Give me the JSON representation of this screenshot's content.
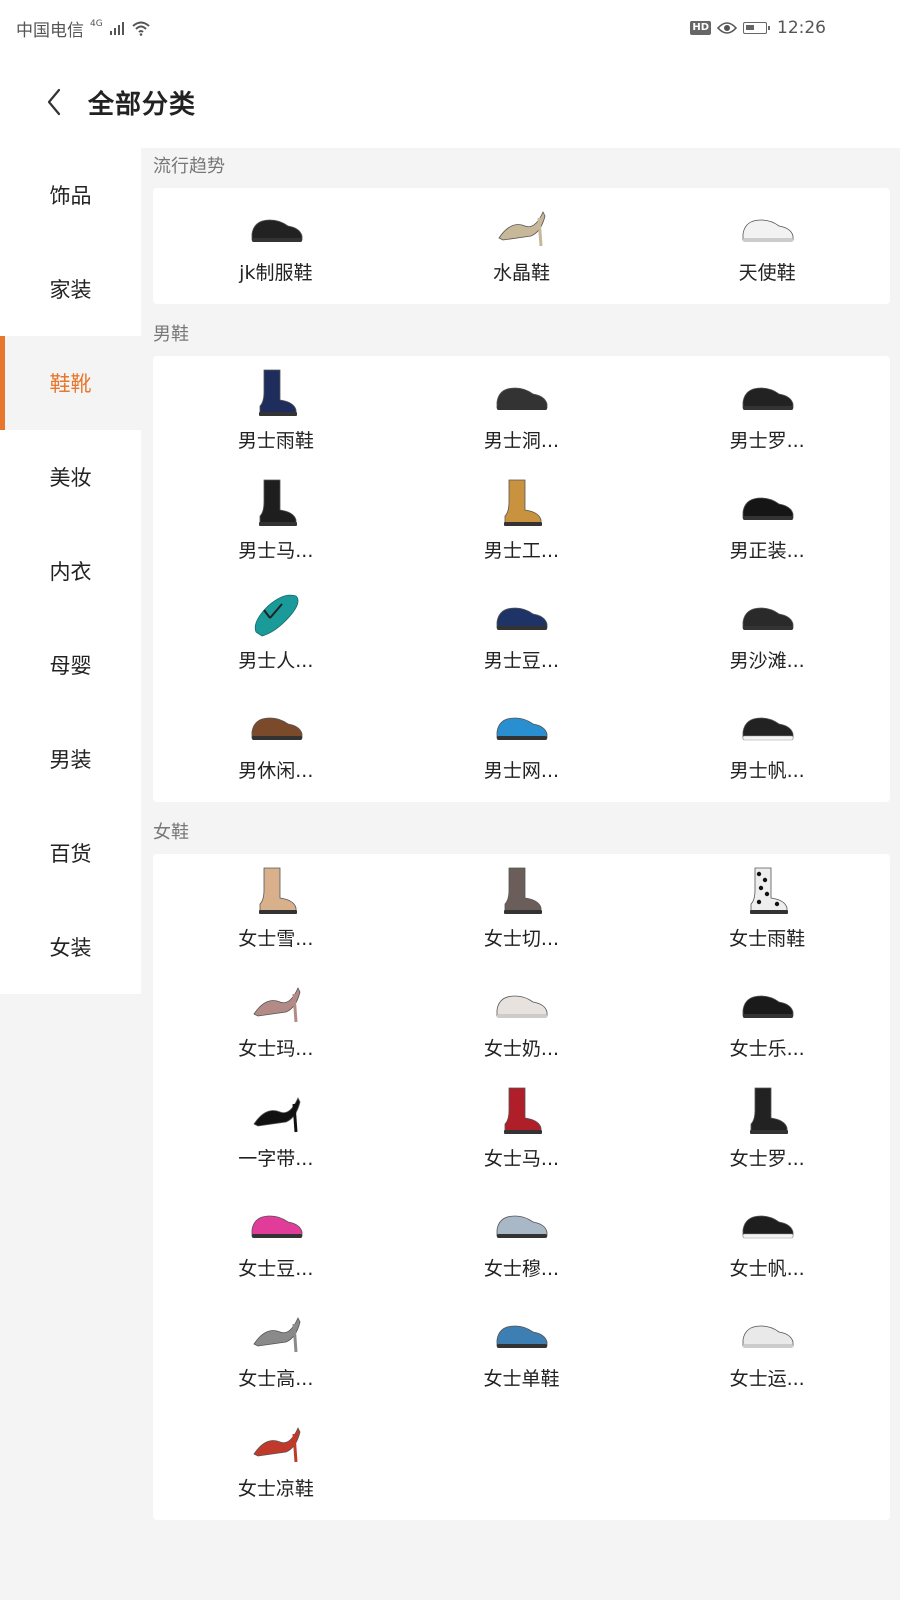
{
  "status": {
    "carrier": "中国电信",
    "network": "4G",
    "time": "12:26"
  },
  "header": {
    "title": "全部分类"
  },
  "sidebar": {
    "items": [
      {
        "label": "饰品"
      },
      {
        "label": "家装"
      },
      {
        "label": "鞋靴",
        "active": true
      },
      {
        "label": "美妆"
      },
      {
        "label": "内衣"
      },
      {
        "label": "母婴"
      },
      {
        "label": "男装"
      },
      {
        "label": "百货"
      },
      {
        "label": "女装"
      }
    ]
  },
  "colors": {
    "accent": "#e8772e",
    "background": "#f4f4f4"
  },
  "sections": [
    {
      "title": "流行趋势",
      "items": [
        {
          "label": "jk制服鞋",
          "icon": "black-loafer-icon"
        },
        {
          "label": "水晶鞋",
          "icon": "crystal-heel-icon"
        },
        {
          "label": "天使鞋",
          "icon": "white-nurse-shoe-icon"
        }
      ]
    },
    {
      "title": "男鞋",
      "items": [
        {
          "label": "男士雨鞋",
          "icon": "rain-boot-icon"
        },
        {
          "label": "男士洞...",
          "icon": "clog-icon"
        },
        {
          "label": "男士罗...",
          "icon": "sandal-icon"
        },
        {
          "label": "男士马...",
          "icon": "martin-boot-icon"
        },
        {
          "label": "男士工...",
          "icon": "work-boot-icon"
        },
        {
          "label": "男正装...",
          "icon": "dress-shoe-icon"
        },
        {
          "label": "男士人...",
          "icon": "flip-flop-icon"
        },
        {
          "label": "男士豆...",
          "icon": "loafer-icon"
        },
        {
          "label": "男沙滩...",
          "icon": "beach-sandal-icon"
        },
        {
          "label": "男休闲...",
          "icon": "casual-shoe-icon"
        },
        {
          "label": "男士网...",
          "icon": "mesh-sneaker-icon"
        },
        {
          "label": "男士帆...",
          "icon": "canvas-shoe-icon"
        }
      ]
    },
    {
      "title": "女鞋",
      "items": [
        {
          "label": "女士雪...",
          "icon": "snow-boot-icon"
        },
        {
          "label": "女士切...",
          "icon": "chelsea-boot-icon"
        },
        {
          "label": "女士雨鞋",
          "icon": "polka-rain-boot-icon"
        },
        {
          "label": "女士玛...",
          "icon": "mary-jane-icon"
        },
        {
          "label": "女士奶...",
          "icon": "grandma-shoe-icon"
        },
        {
          "label": "女士乐...",
          "icon": "tassel-loafer-icon"
        },
        {
          "label": "一字带...",
          "icon": "strap-heel-icon"
        },
        {
          "label": "女士马...",
          "icon": "red-martin-boot-icon"
        },
        {
          "label": "女士罗...",
          "icon": "gladiator-sandal-icon"
        },
        {
          "label": "女士豆...",
          "icon": "pink-loafer-icon"
        },
        {
          "label": "女士穆...",
          "icon": "mule-icon"
        },
        {
          "label": "女士帆...",
          "icon": "canvas-sneaker-icon"
        },
        {
          "label": "女士高...",
          "icon": "high-heel-icon"
        },
        {
          "label": "女士单鞋",
          "icon": "flat-shoe-icon"
        },
        {
          "label": "女士运...",
          "icon": "sport-sneaker-icon"
        },
        {
          "label": "女士凉鞋",
          "icon": "block-heel-sandal-icon"
        }
      ]
    }
  ]
}
